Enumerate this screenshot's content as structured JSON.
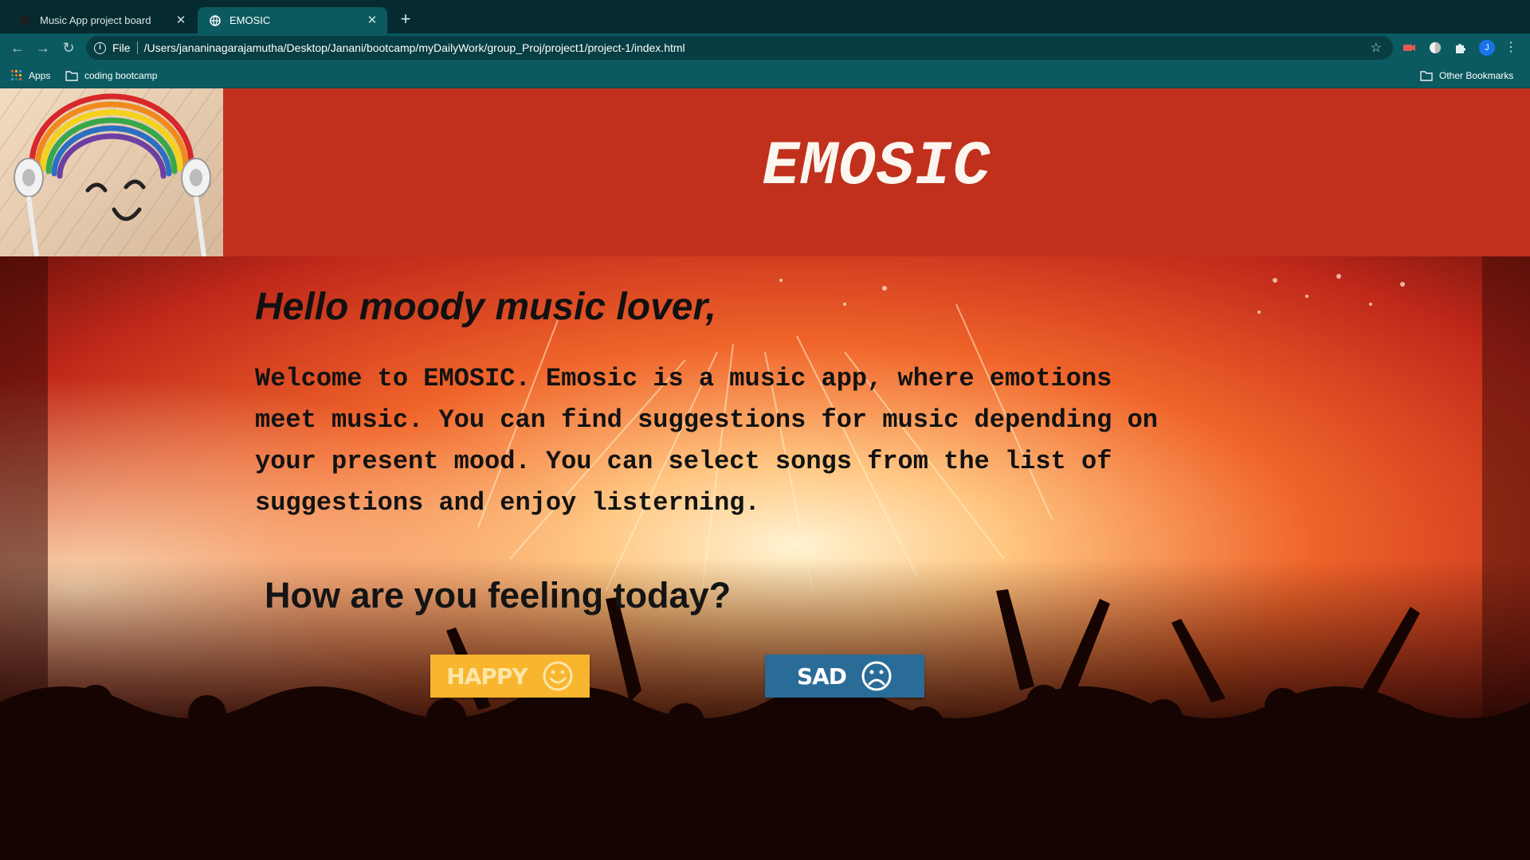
{
  "browser": {
    "tabs": [
      {
        "title": "Music App project board",
        "active": false
      },
      {
        "title": "EMOSIC",
        "active": true
      }
    ],
    "new_tab": "+",
    "address": {
      "scheme": "File",
      "url": "/Users/jananinagarajamutha/Desktop/Janani/bootcamp/myDailyWork/group_Proj/project1/project-1/index.html"
    },
    "profile_initial": "J",
    "bookmarks": {
      "apps": "Apps",
      "folder": "coding bootcamp",
      "other": "Other Bookmarks"
    }
  },
  "page": {
    "brand": "EMOSIC",
    "greeting": "Hello moody music lover,",
    "welcome_lines": [
      "Welcome to EMOSIC. Emosic is a music app, where emotions",
      "meet music. You can find suggestions for music depending on",
      "your present mood. You can select songs from the list of",
      "suggestions and enjoy listerning."
    ],
    "question": "How are you feeling today?",
    "buttons": {
      "happy": "HAPPY",
      "sad": "SAD"
    }
  },
  "colors": {
    "header": "#c0301c",
    "happy": "#f8b52e",
    "sad": "#2a6c98",
    "chrome": "#0b5a60"
  },
  "icons": {
    "happy": "smiley-face-icon",
    "sad": "sad-face-icon"
  }
}
